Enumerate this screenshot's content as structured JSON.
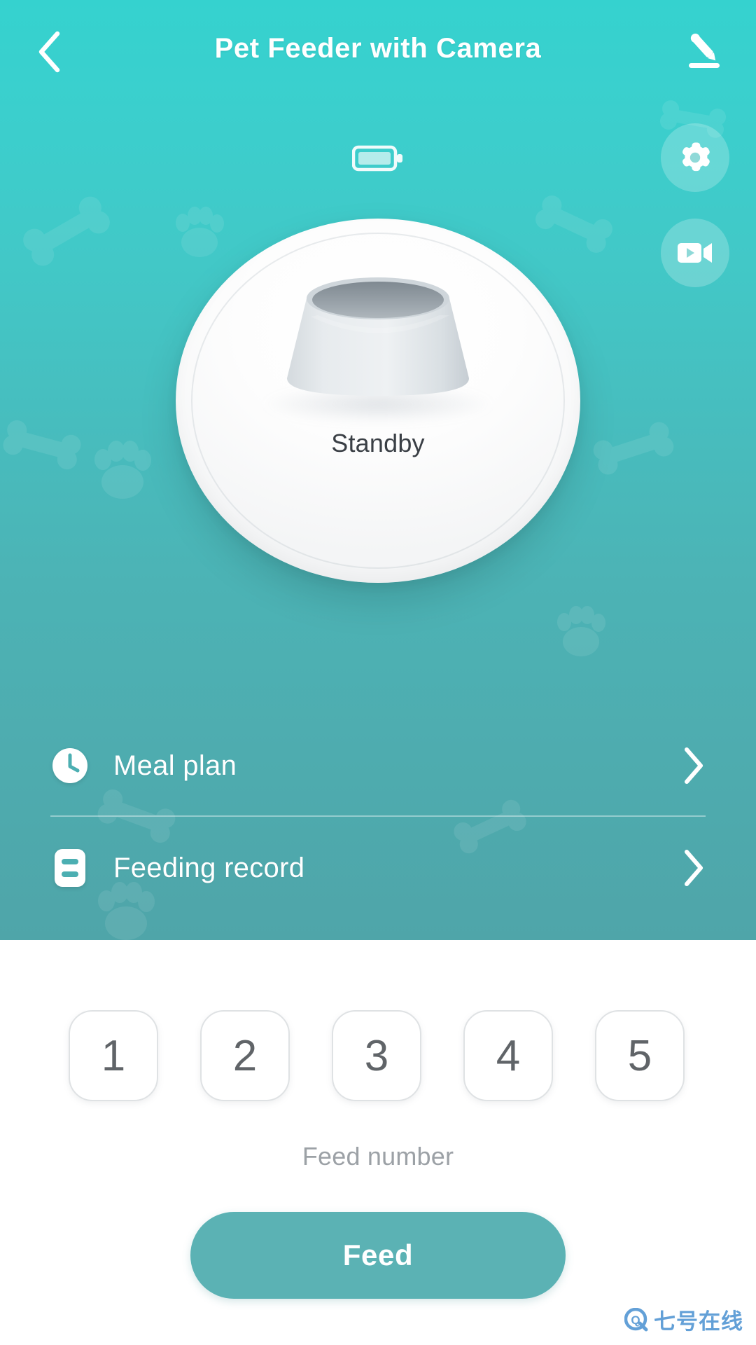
{
  "header": {
    "title": "Pet Feeder with Camera",
    "back_icon": "chevron-left-icon",
    "edit_icon": "pencil-edit-icon"
  },
  "status": {
    "battery_icon": "battery-full-icon",
    "battery_level": "full",
    "device_state": "Standby"
  },
  "side_actions": [
    {
      "name": "settings",
      "icon": "gear-icon"
    },
    {
      "name": "camera",
      "icon": "video-camera-icon"
    }
  ],
  "menu": {
    "items": [
      {
        "label": "Meal plan",
        "icon": "clock-icon",
        "chevron": "chevron-right-icon"
      },
      {
        "label": "Feeding record",
        "icon": "record-list-icon",
        "chevron": "chevron-right-icon"
      }
    ]
  },
  "feed_panel": {
    "numbers": [
      "1",
      "2",
      "3",
      "4",
      "5"
    ],
    "selected": null,
    "label": "Feed number",
    "button_label": "Feed"
  },
  "watermark": {
    "logo": "q-circle-icon",
    "text": "七号在线"
  },
  "colors": {
    "gradient_top": "#35D2CF",
    "gradient_bottom": "#4FA5A9",
    "feed_button": "#5BB2B4",
    "number_text": "#606468",
    "feed_number_label": "#9CA1A6",
    "standby_text": "#3A3F45",
    "watermark": "#5B9BD5"
  }
}
